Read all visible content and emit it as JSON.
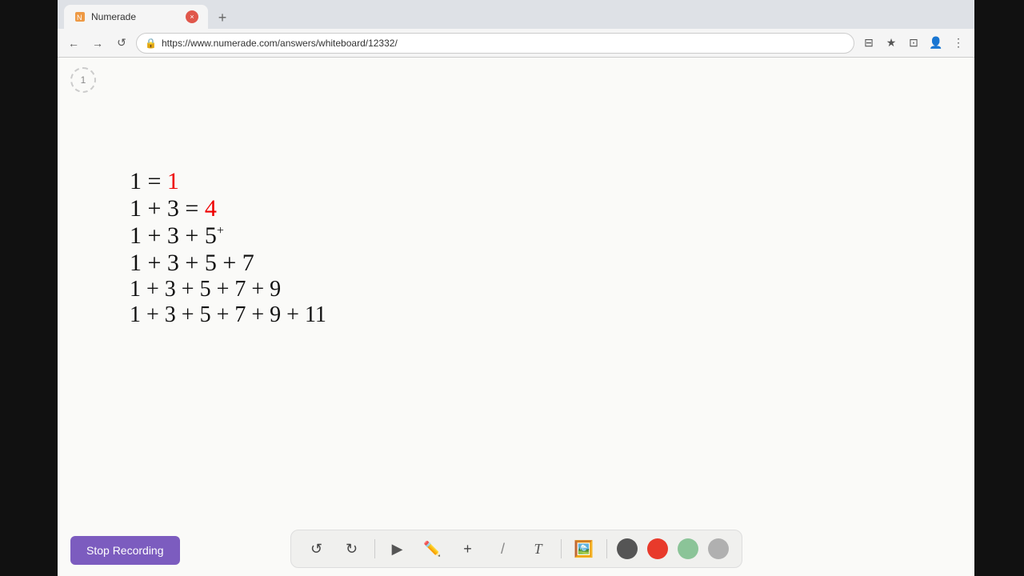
{
  "browser": {
    "tab_title": "Numerade",
    "tab_close_label": "×",
    "tab_new_label": "+",
    "address": "https://www.numerade.com/answers/whiteboard/12332/",
    "nav": {
      "back": "←",
      "forward": "→",
      "reload": "↺"
    },
    "nav_icons": [
      "⊟",
      "★",
      "⊡",
      "👤",
      "⋮"
    ]
  },
  "page_indicator": "1",
  "math_lines": [
    {
      "text": "1 = 1",
      "color": "black"
    },
    {
      "text": "1 + 3 = 4",
      "color": "red_result"
    },
    {
      "text": "1 + 3 + 5⁺",
      "color": "black"
    },
    {
      "text": "1 + 3 + 5 + 7",
      "color": "black"
    },
    {
      "text": "1 + 3 + 5 + 7 + 9",
      "color": "black"
    },
    {
      "text": "1 + 3 + 5 + 7 + 9 + 11",
      "color": "black"
    }
  ],
  "toolbar": {
    "undo_label": "↺",
    "redo_label": "↻",
    "select_label": "▶",
    "pen_label": "✏",
    "plus_label": "+",
    "eraser_label": "/",
    "text_label": "T",
    "image_label": "🖼"
  },
  "stop_recording_label": "Stop Recording",
  "colors": {
    "dark": "#555555",
    "red": "#e83a2b",
    "green": "#8bc498",
    "gray": "#b0b0b0"
  }
}
